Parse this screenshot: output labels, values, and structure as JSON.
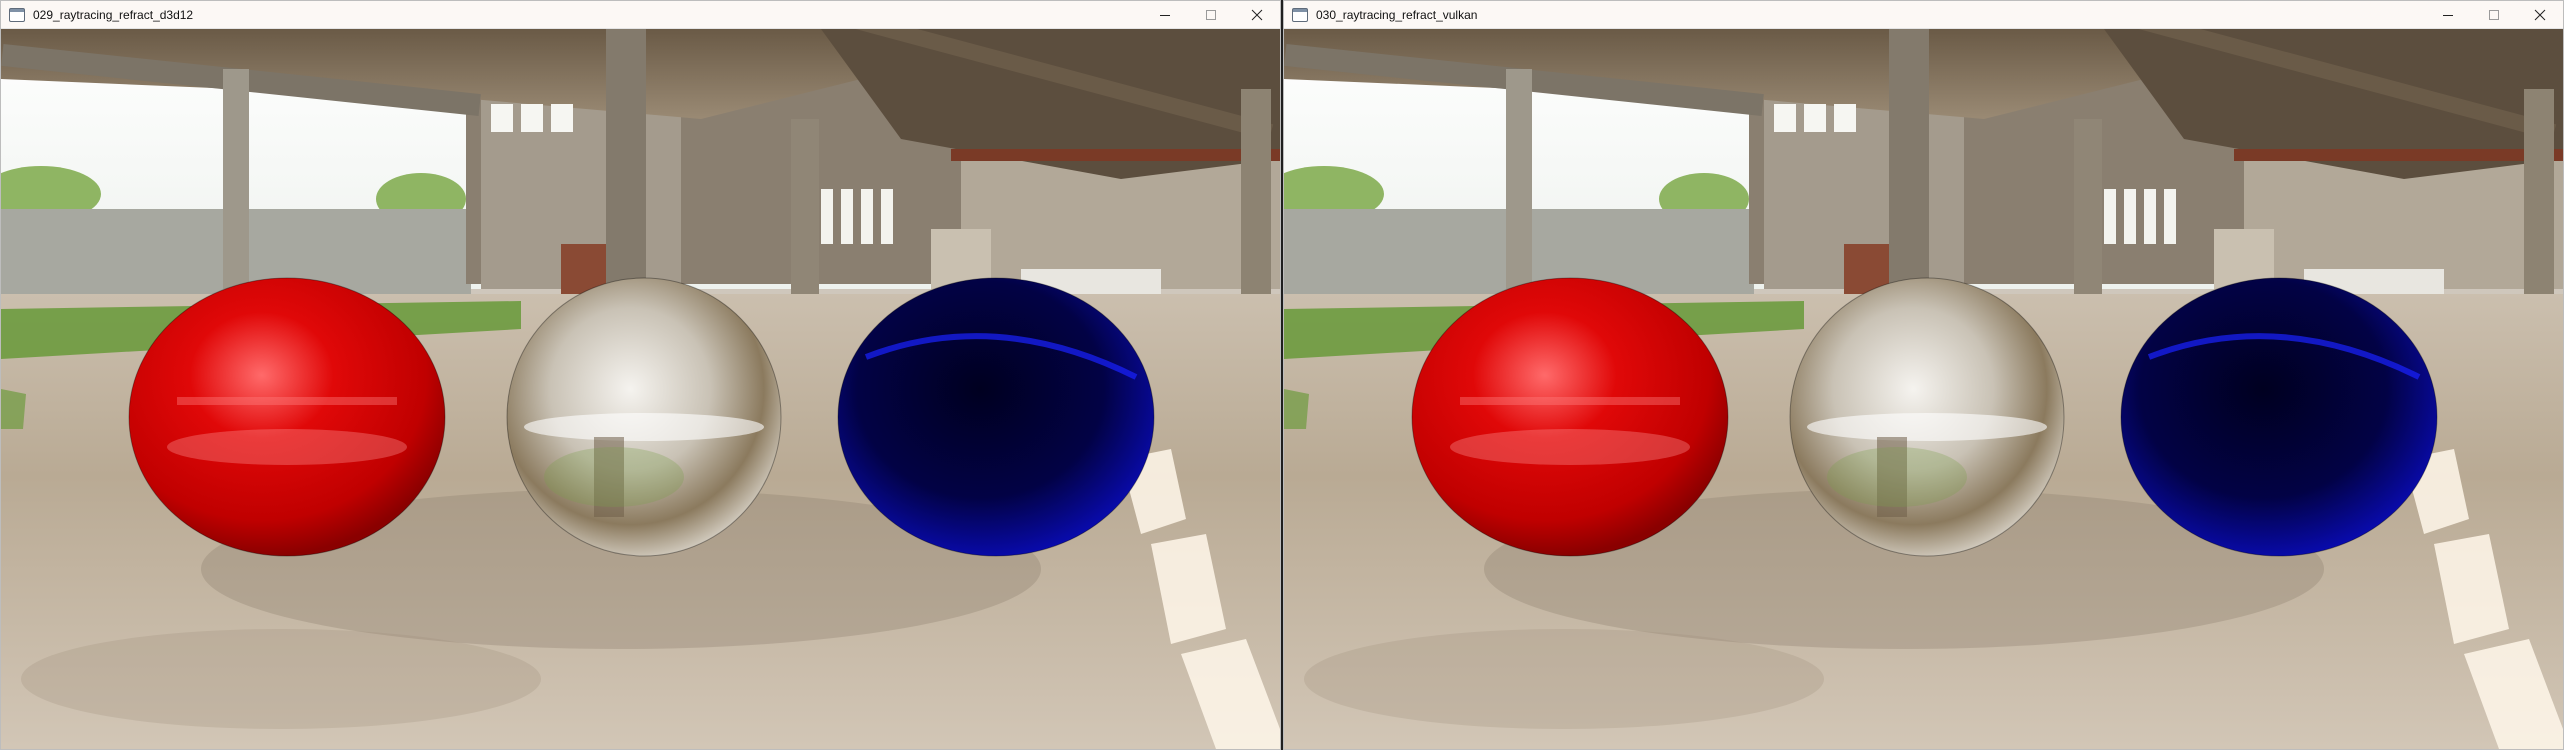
{
  "windows": [
    {
      "title": "029_raytracing_refract_d3d12",
      "controls": {
        "minimize_icon": "minimize-icon",
        "maximize_icon": "maximize-icon",
        "close_icon": "close-icon"
      },
      "scene": {
        "spheres": [
          {
            "name": "red-sphere",
            "color": "#d50000"
          },
          {
            "name": "clear-sphere",
            "color": "#d8d6d2"
          },
          {
            "name": "blue-sphere",
            "color": "#05068d"
          }
        ]
      }
    },
    {
      "title": "030_raytracing_refract_vulkan",
      "controls": {
        "minimize_icon": "minimize-icon",
        "maximize_icon": "maximize-icon",
        "close_icon": "close-icon"
      },
      "scene": {
        "spheres": [
          {
            "name": "red-sphere",
            "color": "#d50000"
          },
          {
            "name": "clear-sphere",
            "color": "#d8d6d2"
          },
          {
            "name": "blue-sphere",
            "color": "#05068d"
          }
        ]
      }
    }
  ],
  "colors": {
    "titlebar": "#fcf8f5",
    "sky": "#ffffff",
    "floor": "#c6b8a3",
    "grass": "#6d9b3f",
    "steel_roof": "#6b5c4a"
  }
}
